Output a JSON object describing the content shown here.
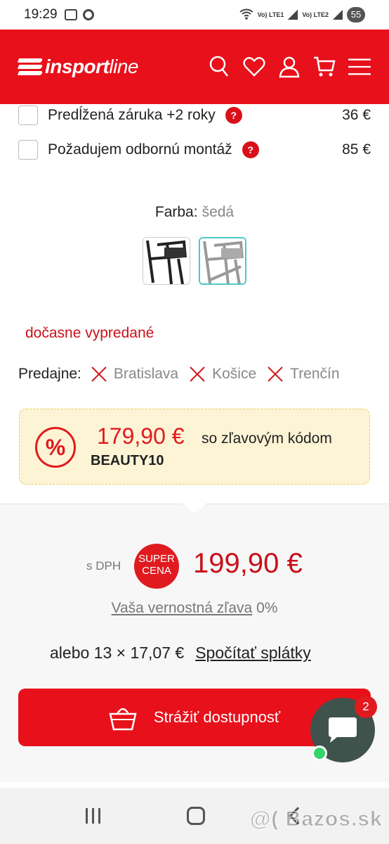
{
  "status_bar": {
    "time": "19:29",
    "net1": "Vo) LTE1",
    "net2": "Vo) LTE2",
    "battery": "55"
  },
  "header": {
    "logo_bold": "insport",
    "logo_light": "line",
    "brand_color": "#e8101b"
  },
  "addons": [
    {
      "label": "Predĺžená záruka +2 roky",
      "price": "36 €",
      "checked": false
    },
    {
      "label": "Požadujem odbornú montáž",
      "price": "85 €",
      "checked": false
    }
  ],
  "color": {
    "label": "Farba:",
    "value": "šedá",
    "selected_index": 1
  },
  "availability": "dočasne vypredané",
  "stores": {
    "label": "Predajne:",
    "items": [
      "Bratislava",
      "Košice",
      "Trenčín"
    ]
  },
  "promo": {
    "icon": "%",
    "price": "179,90 €",
    "text": "so zľavovým kódom",
    "code": "BEAUTY10"
  },
  "pricing": {
    "vat_label": "s DPH",
    "badge_line1": "SUPER",
    "badge_line2": "CENA",
    "price": "199,90 €",
    "loyalty_link": "Vaša vernostná zľava",
    "loyalty_value": "0%",
    "installment_text": "alebo 13 × 17,07 €",
    "installment_link": "Spočítať splátky",
    "watch_button": "Strážiť dostupnosť"
  },
  "chat": {
    "badge": "2"
  },
  "watermark": "@( Bazos.sk"
}
